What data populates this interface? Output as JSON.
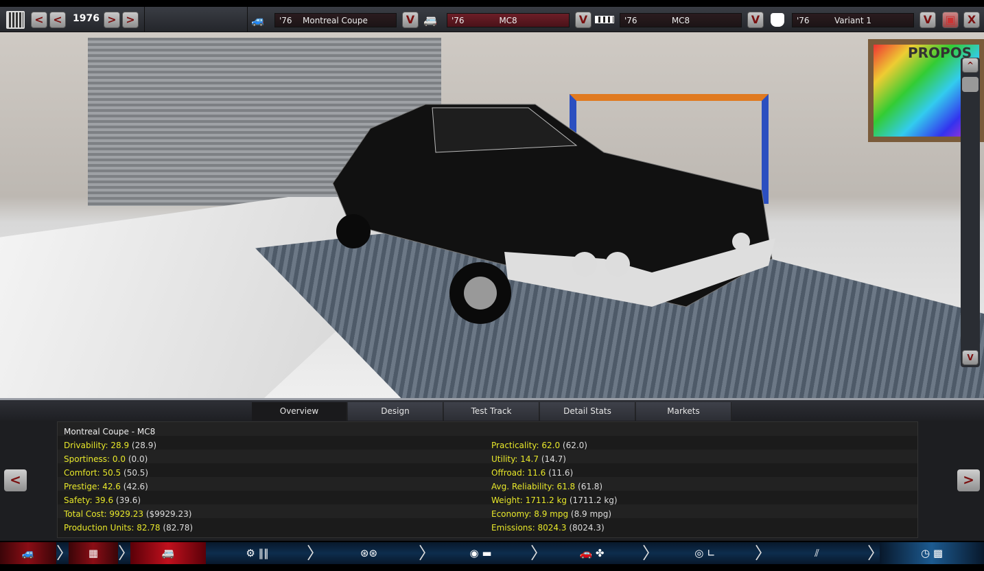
{
  "topbar": {
    "year": "1976",
    "prev_label": "<",
    "next_label": ">",
    "dropdown_label": "V",
    "close_label": "X",
    "selectors": [
      {
        "year": "'76",
        "name": "Montreal Coupe",
        "icon": "car-body-icon"
      },
      {
        "year": "'76",
        "name": "MC8",
        "icon": "car-model-icon"
      },
      {
        "year": "'76",
        "name": "MC8",
        "icon": "engine-icon"
      },
      {
        "year": "'76",
        "name": "Variant 1",
        "icon": "piston-icon"
      }
    ]
  },
  "scene": {
    "poster_text": "PROPOS",
    "scroll_up": "^",
    "scroll_down": "V"
  },
  "tabs": [
    "Overview",
    "Design",
    "Test Track",
    "Detail Stats",
    "Markets"
  ],
  "active_tab": "Overview",
  "stats": {
    "title": "Montreal Coupe - MC8",
    "left": [
      {
        "label": "Drivability: 28.9",
        "paren": "(28.9)"
      },
      {
        "label": "Sportiness: 0.0",
        "paren": "(0.0)"
      },
      {
        "label": "Comfort: 50.5",
        "paren": "(50.5)"
      },
      {
        "label": "Prestige: 42.6",
        "paren": "(42.6)"
      },
      {
        "label": "Safety: 39.6",
        "paren": "(39.6)"
      },
      {
        "label": "Total Cost: 9929.23",
        "paren": "($9929.23)"
      },
      {
        "label": "Production Units: 82.78",
        "paren": "(82.78)"
      }
    ],
    "right": [
      {
        "label": "Practicality: 62.0",
        "paren": "(62.0)"
      },
      {
        "label": "Utility: 14.7",
        "paren": "(14.7)"
      },
      {
        "label": "Offroad: 11.6",
        "paren": "(11.6)"
      },
      {
        "label": "Avg. Reliability: 61.8",
        "paren": "(61.8)"
      },
      {
        "label": "Weight: 1711.2 kg",
        "paren": "(1711.2 kg)"
      },
      {
        "label": "Economy: 8.9 mpg",
        "paren": "(8.9 mpg)"
      },
      {
        "label": "Emissions: 8024.3",
        "paren": "(8024.3)"
      }
    ]
  },
  "navbar": {
    "steps": [
      "car-body",
      "engine",
      "car-model",
      "engine-gearbox",
      "wheels",
      "brakes-body",
      "aero-cooling",
      "interior",
      "suspension",
      "test-track"
    ],
    "active_step": "car-model"
  },
  "colors": {
    "stat_yellow": "#e8e82a",
    "accent_red": "#7a1010",
    "nav_blue": "#0d2d4d"
  }
}
